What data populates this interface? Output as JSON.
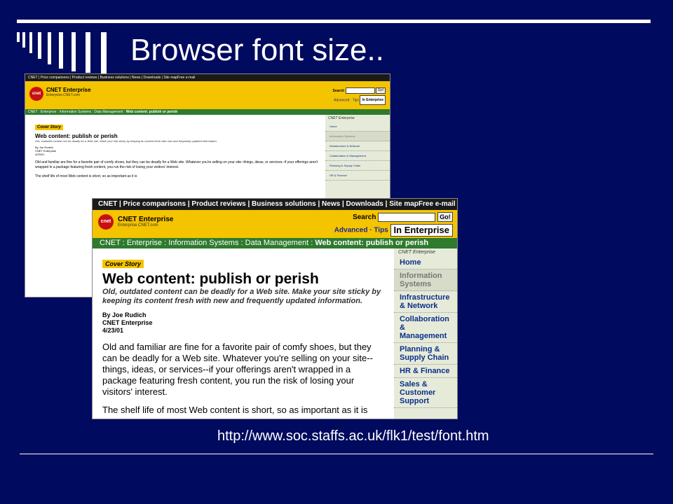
{
  "slide": {
    "title": "Browser font size..",
    "url": "http://www.soc.staffs.ac.uk/flk1/test/font.htm",
    "background_color": "#000a5e",
    "text_color": "#ffffff"
  },
  "screenshot": {
    "top_nav": "CNET | Price comparisons | Product reviews | Business solutions | News | Downloads | Site mapFree e-mail",
    "logo_text": "cnet",
    "brand": "CNET Enterprise",
    "brand_sub": "Enterprise.CNET.com",
    "search_label": "Search",
    "go_label": "Go!",
    "advanced_tips": "Advanced · Tips",
    "search_scope": "In Enterprise",
    "breadcrumb_path": "CNET : Enterprise : Information Systems : Data Management : ",
    "breadcrumb_current": "Web content: publish or perish",
    "sidebar_header": "CNET Enterprise",
    "sidebar_items": [
      "Home",
      "Information Systems",
      "Infrastructure & Network",
      "Collaboration & Management",
      "Planning & Supply Chain",
      "HR & Finance",
      "Sales & Customer Support"
    ],
    "cover_story": "Cover Story",
    "headline": "Web content: publish or perish",
    "dek": "Old, outdated content can be deadly for a Web site. Make your site sticky by keeping its content fresh with new and frequently updated information.",
    "byline_author": "By Joe Rudich",
    "byline_pub": "CNET Enterprise",
    "byline_date": "4/23/01",
    "paragraph1": "Old and familiar are fine for a favorite pair of comfy shoes, but they can be deadly for a Web site. Whatever you're selling on your site--things, ideas, or services--if your offerings aren't wrapped in a package featuring fresh content, you run the risk of losing your visitors' interest.",
    "paragraph2": "The shelf life of most Web content is short, so as important as it is"
  }
}
